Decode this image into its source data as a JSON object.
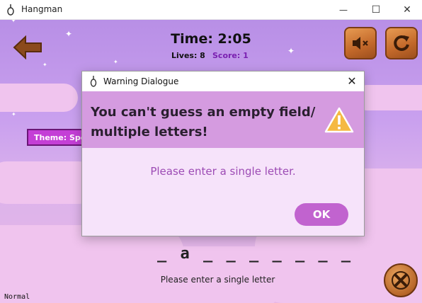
{
  "window": {
    "title": "Hangman",
    "controls": {
      "minimize": "—",
      "maximize": "☐",
      "close": "✕"
    }
  },
  "game": {
    "timer": "Time: 2:05",
    "lives": "Lives: 8",
    "score": "Score: 1",
    "theme_badge": "Theme: Spo",
    "word": "_ a _ _ _ _ _ _ _",
    "hint": "Please enter a single letter",
    "mode": "Normal",
    "icons": [
      "back-arrow-icon",
      "mute-icon",
      "restart-icon",
      "quit-icon"
    ]
  },
  "dialog": {
    "title": "Warning Dialogue",
    "heading": "You can't guess an empty field/ multiple letters!",
    "message": "Please enter a single letter.",
    "ok_label": "OK",
    "close_glyph": "✕"
  },
  "colors": {
    "sky_top": "#b88fe6",
    "cloud": "#f0c4ee",
    "dialog_header": "#d59be0",
    "dialog_body": "#f6e3fa",
    "ok_button": "#c163cf",
    "message_text": "#9c4bb4",
    "wood": "#c2682a",
    "score_text": "#7a1fb0"
  }
}
